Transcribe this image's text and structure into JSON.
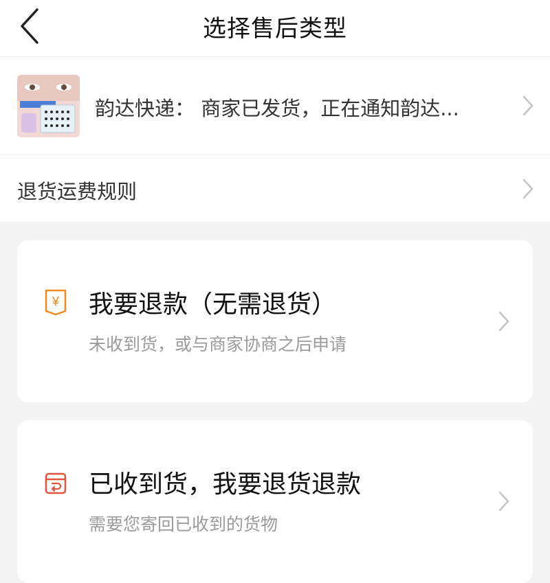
{
  "header": {
    "title": "选择售后类型",
    "back_icon": "chevron-left-icon"
  },
  "order": {
    "text": "韵达快递：  商家已发货，正在通知韵达...",
    "thumbnail_alt": "product-thumbnail"
  },
  "rules": {
    "label": "退货运费规则"
  },
  "options": [
    {
      "title": "我要退款（无需退货）",
      "subtitle": "未收到货，或与商家协商之后申请",
      "icon": "refund-yen-icon"
    },
    {
      "title": "已收到货，我要退货退款",
      "subtitle": "需要您寄回已收到的货物",
      "icon": "return-package-icon"
    }
  ],
  "colors": {
    "accent_orange": "#f08a1c",
    "icon_red": "#e0553b",
    "chevron": "#c4c4c4",
    "subtitle": "#9b9b9b"
  }
}
